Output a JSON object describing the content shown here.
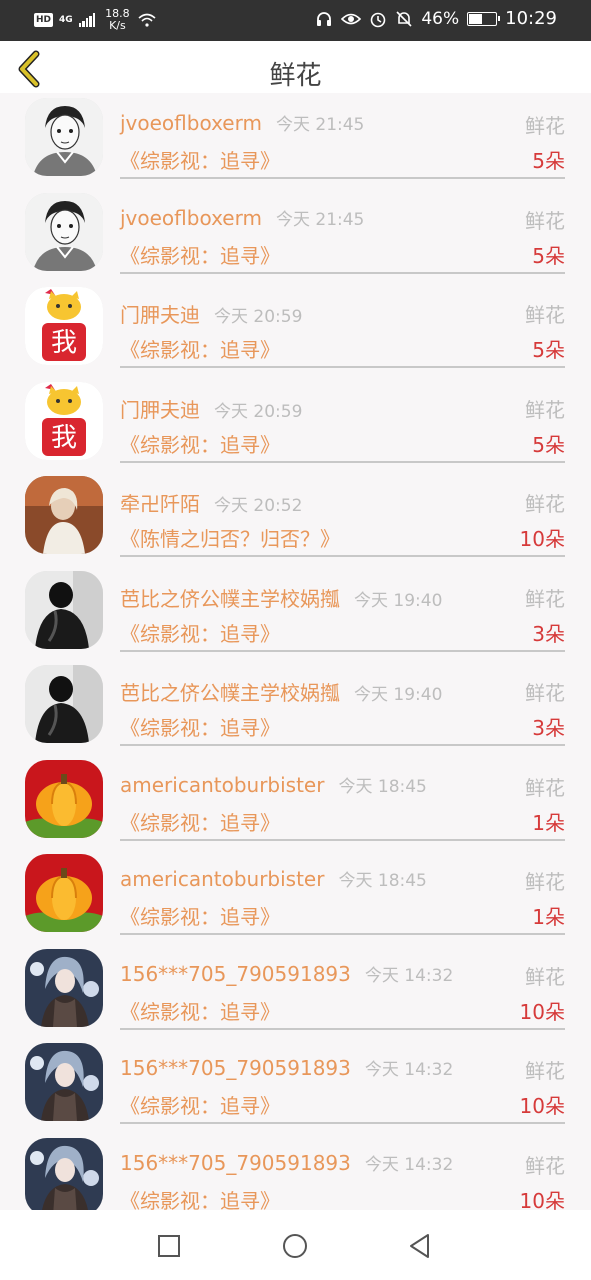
{
  "status_bar": {
    "hd": "HD",
    "network_top": "4G",
    "network_bottom": "⁴⁶",
    "speed_value": "18.8",
    "speed_unit": "K/s",
    "battery": "46%",
    "time": "10:29",
    "icons": [
      "headset-icon",
      "eye-icon",
      "alarm-icon",
      "mute-icon",
      "battery-icon"
    ]
  },
  "header": {
    "title": "鲜花",
    "back_icon": "chevron-left-icon"
  },
  "items": [
    {
      "name": "jvoeoflboxerm",
      "time": "今天 21:45",
      "gift": "鲜花",
      "book": "《综影视：追寻》",
      "count": "5朵",
      "avatar": "sketch-boy"
    },
    {
      "name": "jvoeoflboxerm",
      "time": "今天 21:45",
      "gift": "鲜花",
      "book": "《综影视：追寻》",
      "count": "5朵",
      "avatar": "sketch-boy"
    },
    {
      "name": "门胛夫迪",
      "time": "今天 20:59",
      "gift": "鲜花",
      "book": "《综影视：追寻》",
      "count": "5朵",
      "avatar": "cat-wo"
    },
    {
      "name": "门胛夫迪",
      "time": "今天 20:59",
      "gift": "鲜花",
      "book": "《综影视：追寻》",
      "count": "5朵",
      "avatar": "cat-wo"
    },
    {
      "name": "牵卍阡陌",
      "time": "今天 20:52",
      "gift": "鲜花",
      "book": "《陈情之归否？归否？》",
      "count": "10朵",
      "avatar": "girl-photo"
    },
    {
      "name": "芭比之侪公幞主学校娲摦",
      "time": "今天 19:40",
      "gift": "鲜花",
      "book": "《综影视：追寻》",
      "count": "3朵",
      "avatar": "bw-figure"
    },
    {
      "name": "芭比之侪公幞主学校娲摦",
      "time": "今天 19:40",
      "gift": "鲜花",
      "book": "《综影视：追寻》",
      "count": "3朵",
      "avatar": "bw-figure"
    },
    {
      "name": "americantoburbister",
      "time": "今天 18:45",
      "gift": "鲜花",
      "book": "《综影视：追寻》",
      "count": "1朵",
      "avatar": "pumpkin"
    },
    {
      "name": "americantoburbister",
      "time": "今天 18:45",
      "gift": "鲜花",
      "book": "《综影视：追寻》",
      "count": "1朵",
      "avatar": "pumpkin"
    },
    {
      "name": "156***705_790591893",
      "time": "今天 14:32",
      "gift": "鲜花",
      "book": "《综影视：追寻》",
      "count": "10朵",
      "avatar": "anime-girl"
    },
    {
      "name": "156***705_790591893",
      "time": "今天 14:32",
      "gift": "鲜花",
      "book": "《综影视：追寻》",
      "count": "10朵",
      "avatar": "anime-girl"
    },
    {
      "name": "156***705_790591893",
      "time": "今天 14:32",
      "gift": "鲜花",
      "book": "《综影视：追寻》",
      "count": "10朵",
      "avatar": "anime-girl"
    }
  ],
  "nav": {
    "icons": [
      "square-recents-icon",
      "circle-home-icon",
      "triangle-back-icon"
    ]
  },
  "colors": {
    "name": "#e8975a",
    "count": "#d63a3a",
    "muted": "#bdbdbd",
    "back": "#d9c12a"
  }
}
